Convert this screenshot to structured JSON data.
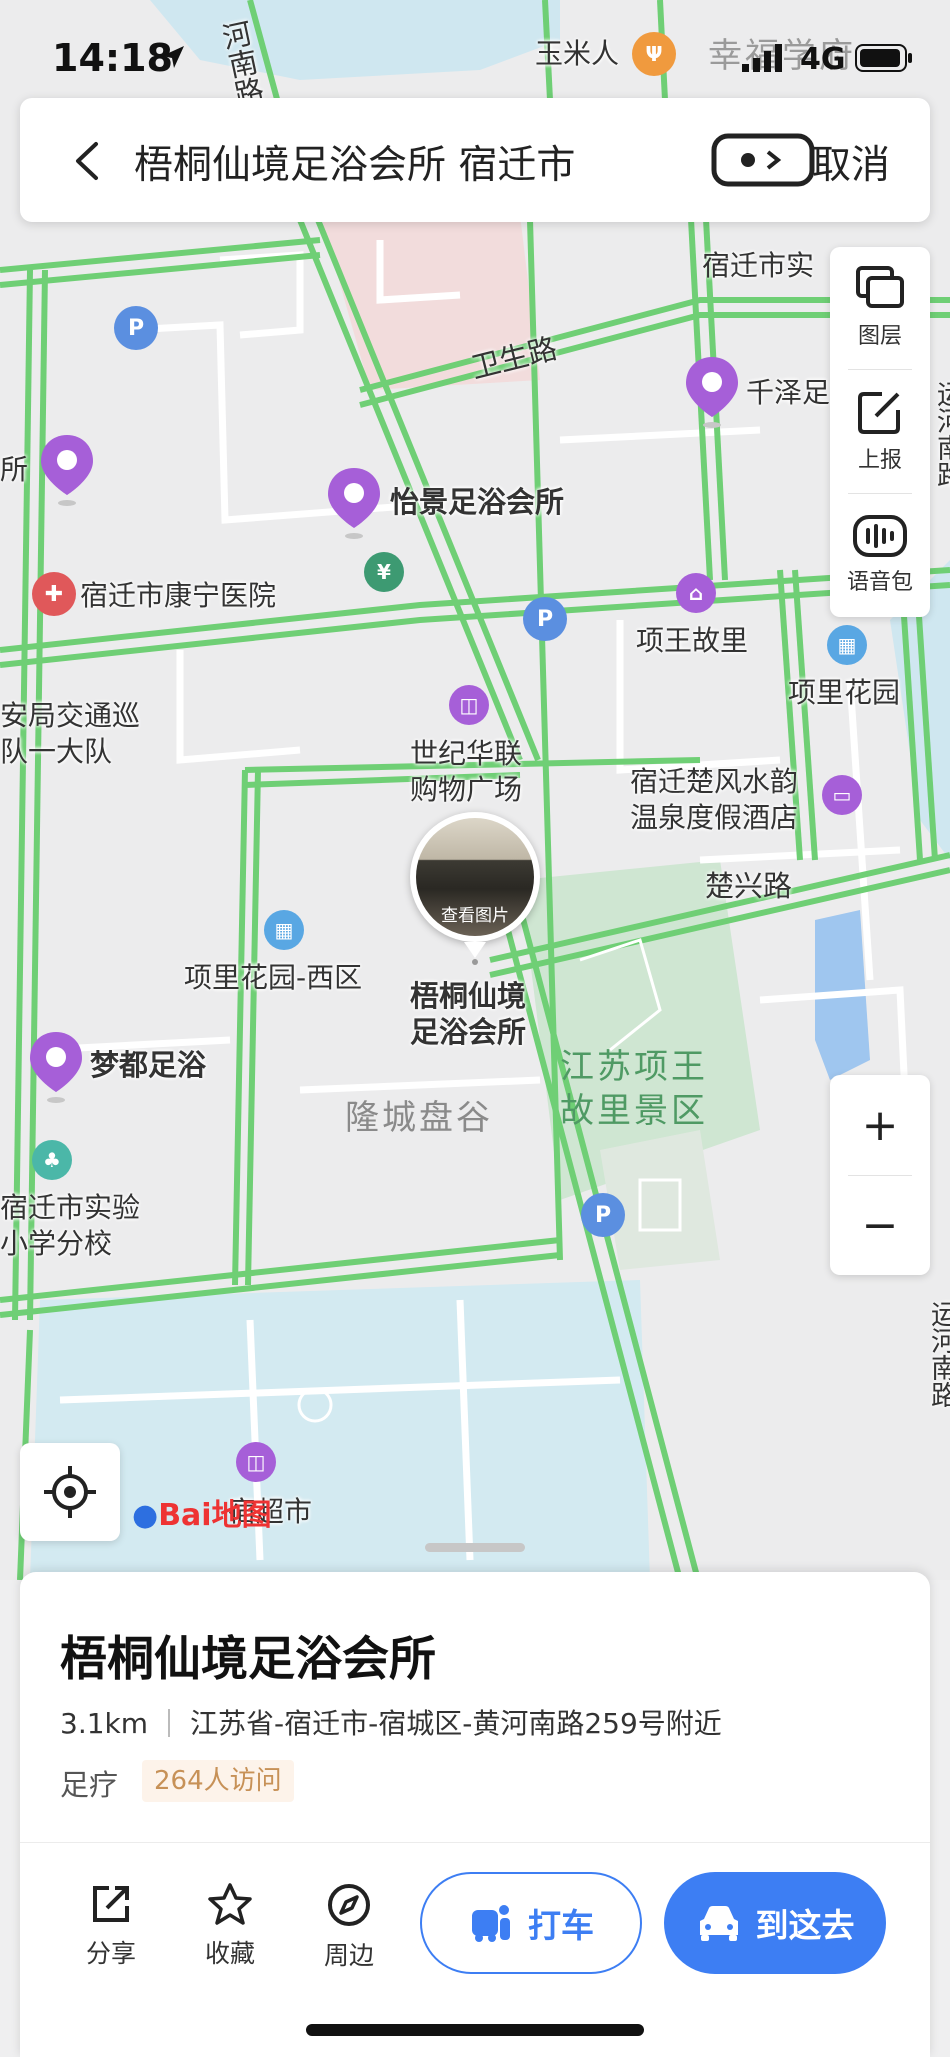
{
  "status_bar": {
    "time": "14:18",
    "network": "4G"
  },
  "search": {
    "query": "梧桐仙境足浴会所 宿迁市",
    "cancel_label": "取消"
  },
  "right_tools": [
    {
      "label": "图层",
      "icon": "layers-icon"
    },
    {
      "label": "上报",
      "icon": "report-edit-icon"
    },
    {
      "label": "语音包",
      "icon": "voice-pack-icon"
    }
  ],
  "zoom": {
    "in": "+",
    "out": "−"
  },
  "map": {
    "roads": {
      "weisheng": "卫生路",
      "chuxing": "楚兴路",
      "henan_top": "河南路",
      "yunhe_right_top": "运河南路",
      "yunhe_right_bottom": "运河南路"
    },
    "pois": {
      "yumiren": "玉米人",
      "xingfu": "幸福学府",
      "suqian_shiyan_top": "宿迁市实",
      "qianze": "千泽足",
      "suo_left": "所",
      "yijing": "怡景足浴会所",
      "kangning": "宿迁市康宁医院",
      "xiangwang": "项王故里",
      "xiangli_garden": "项里花园",
      "traffic_police": "安局交通巡\n队一大队",
      "century": "世纪华联\n购物广场",
      "spa_hotel": "宿迁楚风水韵\n温泉度假酒店",
      "xiangli_west": "项里花园-西区",
      "target": "梧桐仙境\n足浴会所",
      "photo_label": "查看图片",
      "mengdu": "梦都足浴",
      "school": "宿迁市实验\n小学分校",
      "supermarket": "宿超市",
      "longcheng": "隆城盘谷",
      "scenic": "江苏项王\n故里景区"
    },
    "logo": "Bai地图"
  },
  "place": {
    "name": "梧桐仙境足浴会所",
    "distance": "3.1km",
    "address": "江苏省-宿迁市-宿城区-黄河南路259号附近",
    "category": "足疗",
    "visits": "264人访问"
  },
  "actions": [
    {
      "label": "分享",
      "icon": "share-icon"
    },
    {
      "label": "收藏",
      "icon": "star-icon"
    },
    {
      "label": "周边",
      "icon": "compass-icon"
    }
  ],
  "buttons": {
    "taxi": "打车",
    "go": "到这去"
  },
  "colors": {
    "accent": "#3d7ef3",
    "road": "#6fcf75",
    "poi_purple": "#a65fd8",
    "water": "#cfe7f0"
  }
}
